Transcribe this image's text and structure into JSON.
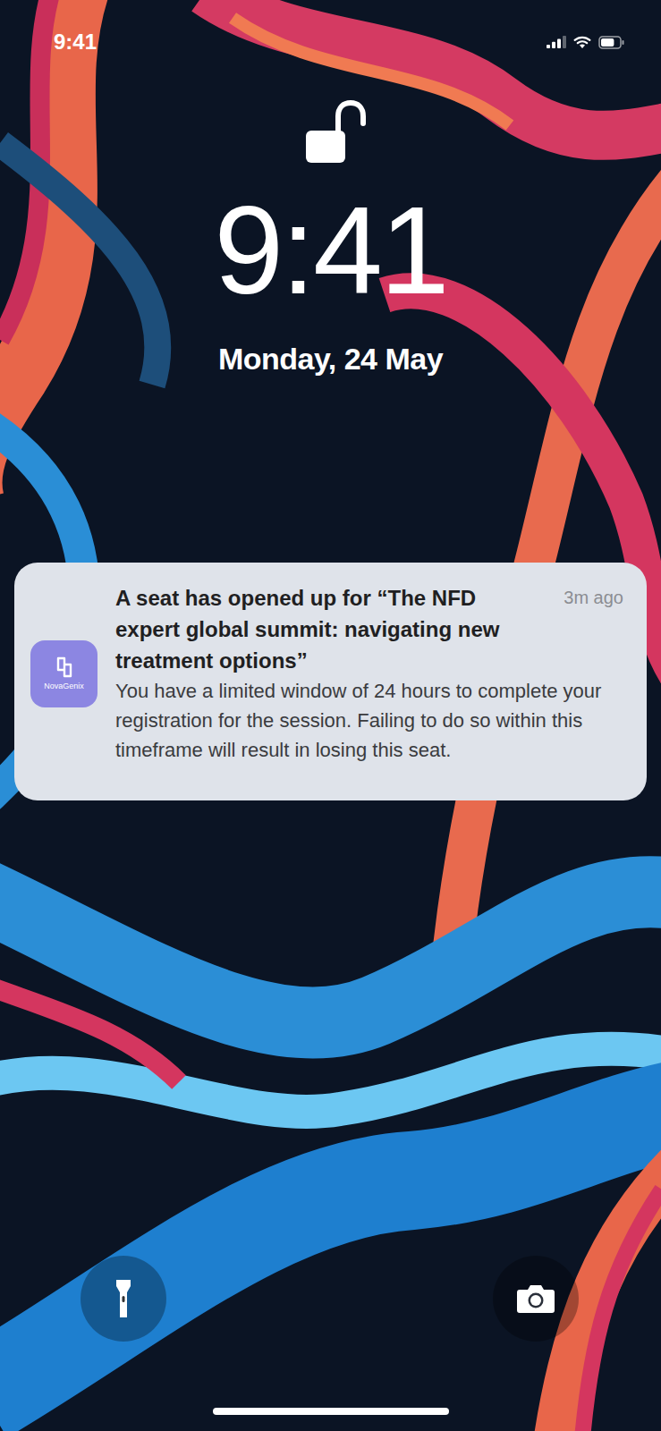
{
  "status_bar": {
    "time": "9:41",
    "signal_level": 0.75,
    "wifi_on": true,
    "battery_level": 0.72
  },
  "lock": {
    "unlocked": true
  },
  "clock": {
    "time": "9:41",
    "date": "Monday, 24 May"
  },
  "notification": {
    "app": "NovaGenix",
    "title": "A seat has opened up for “The NFD expert global summit: navigating new treatment options”",
    "body": "You have a limited window of 24 hours to complete your registration for the session. Failing to do so within this timeframe will result in losing this seat.",
    "time": "3m ago"
  }
}
